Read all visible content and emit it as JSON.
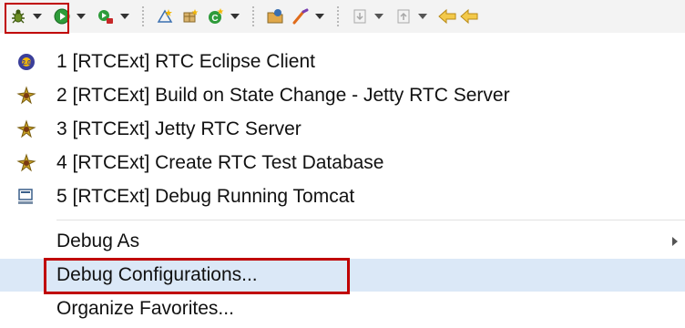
{
  "toolbar": {
    "buttons": [
      {
        "icon": "debug-bug-icon"
      },
      {
        "icon": "run-icon"
      },
      {
        "icon": "external-tools-icon"
      },
      {
        "icon": "new-java-project-icon"
      },
      {
        "icon": "new-package-icon"
      },
      {
        "icon": "new-class-icon"
      },
      {
        "icon": "open-type-icon"
      },
      {
        "icon": "search-icon"
      },
      {
        "icon": "next-annotation-icon"
      },
      {
        "icon": "previous-annotation-icon"
      },
      {
        "icon": "back-icon"
      },
      {
        "icon": "forward-icon"
      }
    ],
    "colors": {
      "highlight": "#c00000",
      "run_green": "#2e9b3a"
    }
  },
  "menu": {
    "history": [
      {
        "label": "1 [RTCExt] RTC Eclipse Client",
        "icon": "rtc-client-launch-icon"
      },
      {
        "label": "2 [RTCExt] Build on State Change - Jetty RTC Server",
        "icon": "jetty-server-launch-icon"
      },
      {
        "label": "3 [RTCExt] Jetty RTC Server",
        "icon": "jetty-server-launch-icon"
      },
      {
        "label": "4 [RTCExt] Create RTC Test Database",
        "icon": "jetty-server-launch-icon"
      },
      {
        "label": "5 [RTCExt] Debug Running Tomcat",
        "icon": "remote-java-app-icon"
      }
    ],
    "actions": [
      {
        "label": "Debug As",
        "has_submenu": true
      },
      {
        "label": "Debug Configurations...",
        "highlighted": true
      },
      {
        "label": "Organize Favorites..."
      }
    ],
    "colors": {
      "hover_bg": "#dbe8f7",
      "highlight_border": "#c00000"
    }
  }
}
